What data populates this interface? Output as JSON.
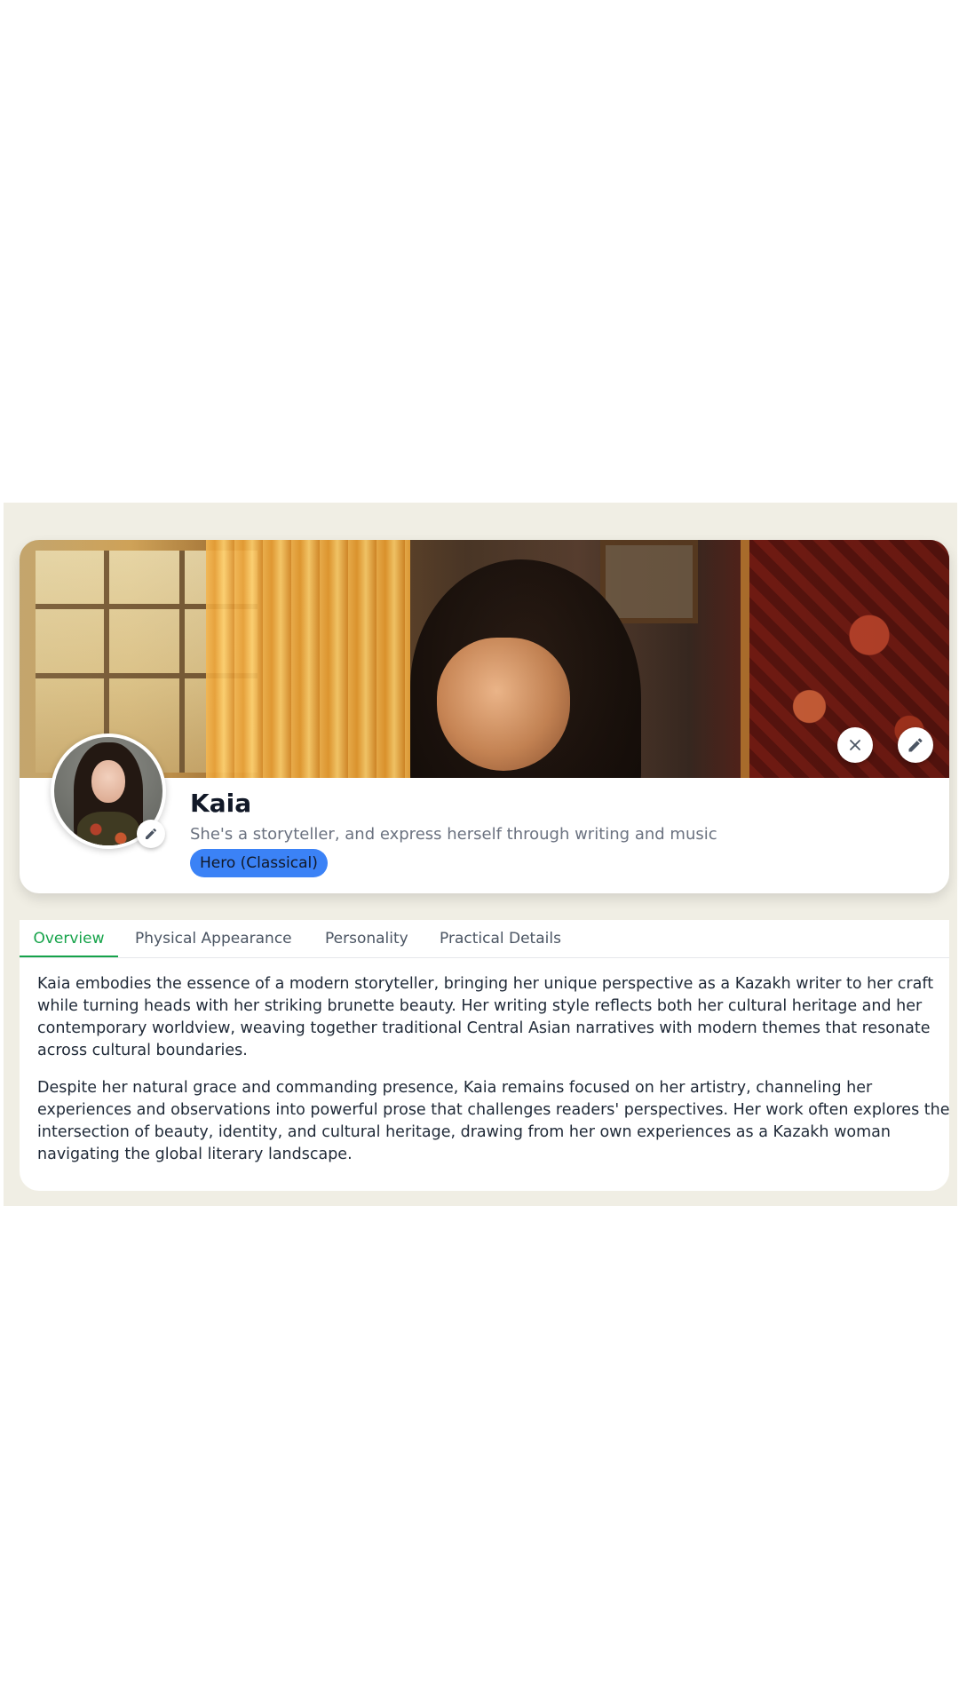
{
  "profile": {
    "name": "Kaia",
    "tagline": "She's a storyteller, and express herself through writing and music",
    "badge": "Hero (Classical)",
    "icons": {
      "close": "close-icon",
      "edit": "pencil-icon",
      "avatar_edit": "pencil-icon"
    }
  },
  "tabs": [
    {
      "label": "Overview",
      "active": true
    },
    {
      "label": "Physical Appearance",
      "active": false
    },
    {
      "label": "Personality",
      "active": false
    },
    {
      "label": "Practical Details",
      "active": false
    }
  ],
  "overview": {
    "paragraphs": [
      "Kaia embodies the essence of a modern storyteller, bringing her unique perspective as a Kazakh writer to her craft while turning heads with her striking brunette beauty. Her writing style reflects both her cultural heritage and her contemporary worldview, weaving together traditional Central Asian narratives with modern themes that resonate across cultural boundaries.",
      "Despite her natural grace and commanding presence, Kaia remains focused on her artistry, channeling her experiences and observations into powerful prose that challenges readers' perspectives. Her work often explores the intersection of beauty, identity, and cultural heritage, drawing from her own experiences as a Kazakh woman navigating the global literary landscape."
    ]
  },
  "colors": {
    "page_background": "#ffffff",
    "panel_background": "#f0eee4",
    "accent_green": "#16a34a",
    "badge_blue": "#3b82f6",
    "name_text": "#111827",
    "muted_text": "#6b7280"
  }
}
